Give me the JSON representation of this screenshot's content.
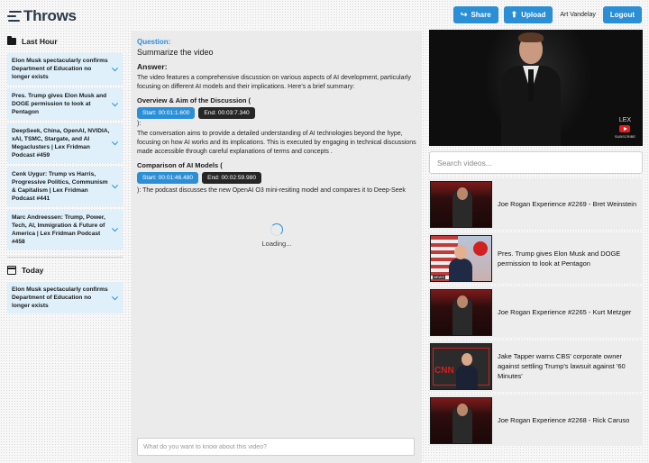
{
  "header": {
    "logo_text": "Throws",
    "share_label": "Share",
    "upload_label": "Upload",
    "user_name": "Art Vandelay",
    "logout_label": "Logout"
  },
  "sidebar": {
    "last_hour_title": "Last Hour",
    "last_hour_items": [
      "Elon Musk spectacularly confirms Department of Education no longer exists",
      "Pres. Trump gives Elon Musk and DOGE permission to look at Pentagon",
      "DeepSeek, China, OpenAI, NVIDIA, xAI, TSMC, Stargate, and AI Megaclusters | Lex Fridman Podcast #459",
      "Cenk Uygur: Trump vs Harris, Progressive Politics, Communism & Capitalism | Lex Fridman Podcast #441",
      "Marc Andreessen: Trump, Power, Tech, AI, Immigration & Future of America | Lex Fridman Podcast #458"
    ],
    "today_title": "Today",
    "today_items": [
      "Elon Musk spectacularly confirms Department of Education no longer exists"
    ]
  },
  "chat": {
    "question_label": "Question:",
    "question_text": "Summarize the video",
    "answer_label": "Answer:",
    "intro": "The video features a comprehensive discussion on various aspects of AI development, particularly focusing on different AI models and their implications. Here's a brief summary:",
    "section1_title": "Overview & Aim of the Discussion (",
    "section1_start": "Start: 00:01:1.600",
    "section1_end": "End: 00:03:7.340",
    "section1_close": "):",
    "section1_body": "The conversation aims to provide a detailed understanding of AI technologies beyond the hype, focusing on how AI works and its implications. This is executed by engaging in technical discussions made accessible through careful explanations of terms and concepts .",
    "section2_title": "Comparison of AI Models (",
    "section2_start": "Start: 00:01:46.480",
    "section2_end": "End: 00:02:59.980",
    "section2_close": "):",
    "section2_body": "The podcast discusses the new OpenAI O3 mini-resiting model and compares it to Deep-Seek",
    "loading_text": "Loading...",
    "input_placeholder": "What do you want to know about this video?"
  },
  "player": {
    "badge_text": "LEX",
    "badge_sub": "SUBSCRIBE"
  },
  "search": {
    "placeholder": "Search videos..."
  },
  "videos": [
    "Joe Rogan Experience #2269 - Bret Weinstein",
    "Pres. Trump gives Elon Musk and DOGE permission to look at Pentagon",
    "Joe Rogan Experience #2265 - Kurt Metzger",
    "Jake Tapper warns CBS' corporate owner against settling Trump's lawsuit against '60 Minutes'",
    "Joe Rogan Experience #2268 - Rick Caruso"
  ],
  "thumb_labels": {
    "news_tag": "NEWS",
    "cnn_logo": "CNN"
  },
  "icons": {
    "share": "share-icon",
    "upload": "upload-icon",
    "folder": "folder-icon",
    "calendar": "calendar-icon"
  },
  "colors": {
    "accent": "#2b8fd6",
    "item_bg": "#dff0fa"
  }
}
